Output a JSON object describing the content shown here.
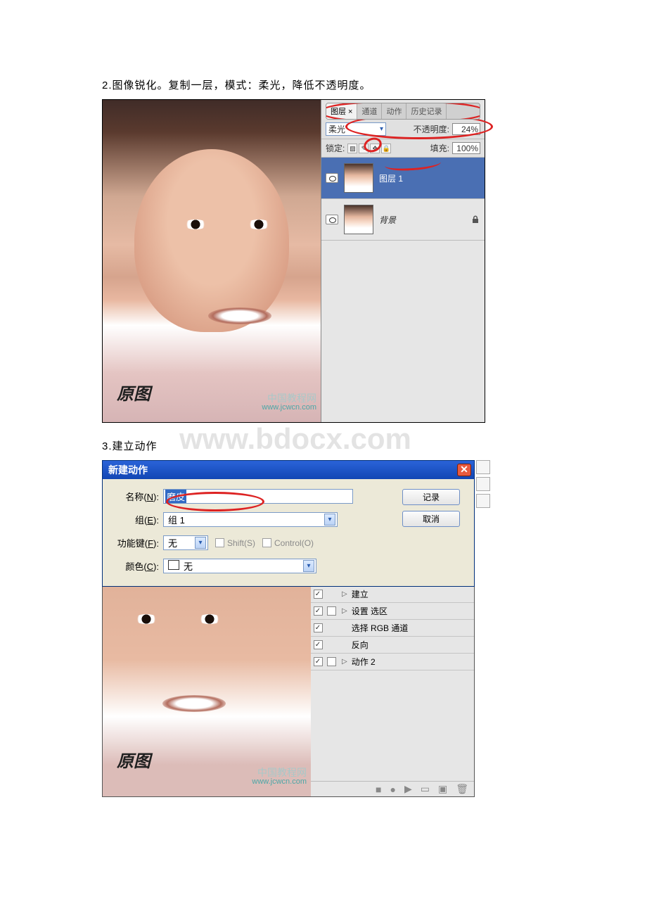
{
  "step2_text": "2.图像锐化。复制一层，模式：柔光，降低不透明度。",
  "step3_text": "3.建立动作",
  "watermark": "www.bdocx.com",
  "photo_label": "原图",
  "site_watermark_zh": "中国教程网",
  "site_watermark_url": "www.jcwcn.com",
  "layers_panel": {
    "tabs": [
      "图层 ×",
      "通道",
      "动作",
      "历史记录"
    ],
    "blend_label": "柔光",
    "opacity_label": "不透明度:",
    "opacity_value": "24%",
    "lock_label": "锁定:",
    "fill_label": "填充:",
    "fill_value": "100%",
    "layers": [
      {
        "name": "图层 1",
        "locked": false
      },
      {
        "name": "背景",
        "locked": true
      }
    ]
  },
  "new_action_dialog": {
    "title": "新建动作",
    "name_label": "名称(N):",
    "name_value": "磨皮",
    "group_label": "组(E):",
    "group_value": "组 1",
    "fnkey_label": "功能键(F):",
    "fnkey_value": "无",
    "shift_label": "Shift(S)",
    "ctrl_label": "Control(O)",
    "color_label": "颜色(C):",
    "color_value": "无",
    "btn_record": "记录",
    "btn_cancel": "取消"
  },
  "actions_panel": {
    "rows": [
      {
        "checked": true,
        "modal": false,
        "expand": true,
        "name": "建立"
      },
      {
        "checked": true,
        "modal": true,
        "expand": true,
        "name": "设置 选区"
      },
      {
        "checked": true,
        "modal": false,
        "expand": false,
        "name": "选择 RGB 通道"
      },
      {
        "checked": true,
        "modal": false,
        "expand": false,
        "name": "反向"
      },
      {
        "checked": true,
        "modal": true,
        "expand": true,
        "name": "动作 2"
      }
    ]
  }
}
